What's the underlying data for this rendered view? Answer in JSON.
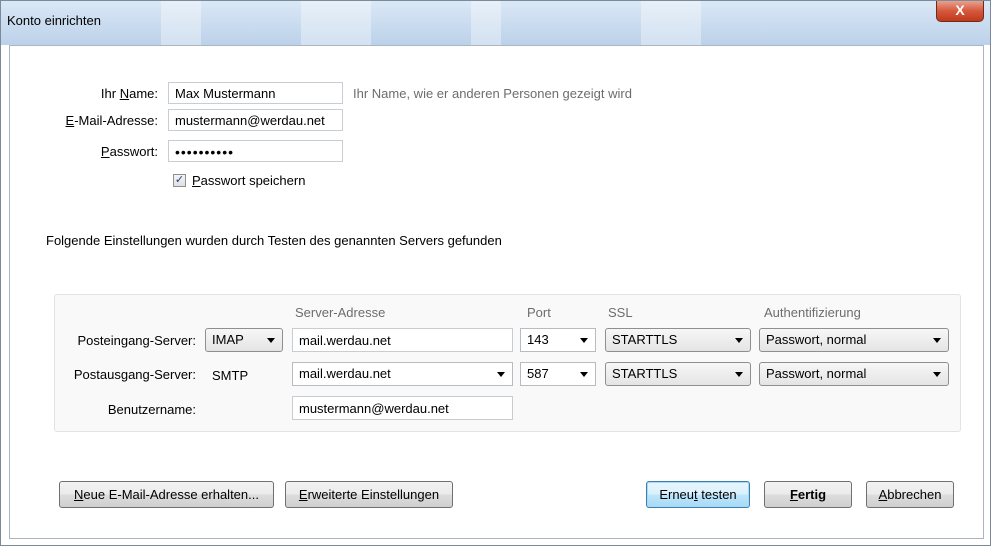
{
  "window": {
    "title": "Konto einrichten",
    "close_glyph": "X"
  },
  "account": {
    "name_label_pre": "Ihr ",
    "name_label_u": "N",
    "name_label_post": "ame:",
    "name_value": "Max Mustermann",
    "name_hint": "Ihr Name, wie er anderen Personen gezeigt wird",
    "email_label_u": "E",
    "email_label_post": "-Mail-Adresse:",
    "email_value": "mustermann@werdau.net",
    "password_label_u": "P",
    "password_label_post": "asswort:",
    "password_value": "••••••••••",
    "save_password_checked": true,
    "save_password_u": "P",
    "save_password_post": "asswort speichern"
  },
  "status_message": "Folgende Einstellungen wurden durch Testen des genannten Servers gefunden",
  "server_table": {
    "headers": {
      "address": "Server-Adresse",
      "port": "Port",
      "ssl": "SSL",
      "auth": "Authentifizierung"
    },
    "incoming": {
      "label": "Posteingang-Server:",
      "protocol": "IMAP",
      "address": "mail.werdau.net",
      "port": "143",
      "ssl": "STARTTLS",
      "auth": "Passwort, normal"
    },
    "outgoing": {
      "label": "Postausgang-Server:",
      "protocol": "SMTP",
      "address": "mail.werdau.net",
      "port": "587",
      "ssl": "STARTTLS",
      "auth": "Passwort, normal"
    },
    "username": {
      "label": "Benutzername:",
      "value": "mustermann@werdau.net"
    }
  },
  "buttons": {
    "new_email_u": "N",
    "new_email_post": "eue E-Mail-Adresse erhalten...",
    "advanced_u": "E",
    "advanced_post": "rweiterte Einstellungen",
    "retest_pre": "Erneu",
    "retest_u": "t",
    "retest_post": " testen",
    "done_u": "F",
    "done_post": "ertig",
    "cancel_u": "A",
    "cancel_post": "bbrechen"
  }
}
